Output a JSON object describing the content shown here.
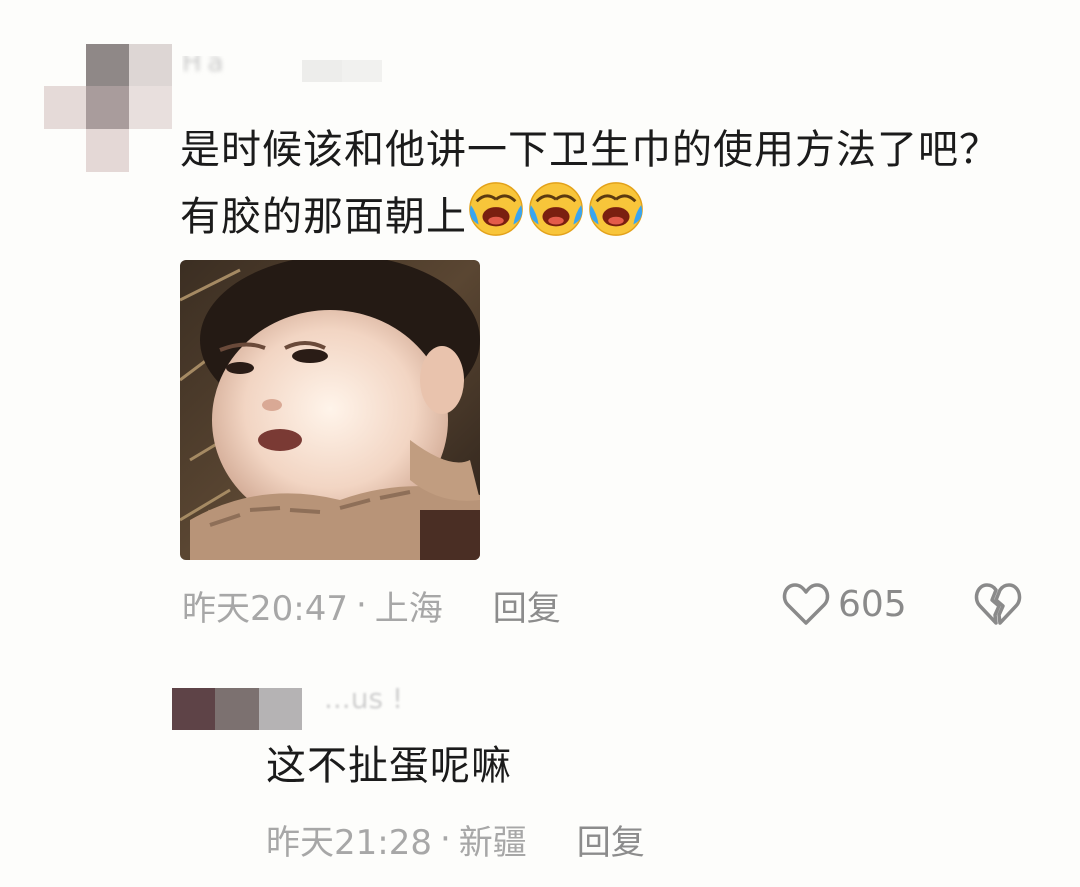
{
  "main_comment": {
    "username": "Ha",
    "text": "是时候该和他讲一下卫生巾的使用方法了吧？有胶的那面朝上",
    "emojis": [
      "laughing-crying-emoji",
      "laughing-crying-emoji",
      "laughing-crying-emoji"
    ],
    "image": {
      "icon": "crying-toddler-meme-photo"
    },
    "time": "昨天20:47",
    "separator": "·",
    "location": "上海",
    "reply_label": "回复",
    "like_count": "605",
    "like_icon": "heart-outline-icon",
    "dislike_icon": "broken-heart-icon"
  },
  "reply_comment": {
    "username": "...us !",
    "text": "这不扯蛋呢嘛",
    "time": "昨天21:28",
    "separator": "·",
    "location": "新疆",
    "reply_label": "回复"
  },
  "colors": {
    "background": "#fdfdfb",
    "text_primary": "#1b1b1b",
    "text_meta": "#a7a7a7",
    "icon_gray": "#8a8a8a"
  }
}
